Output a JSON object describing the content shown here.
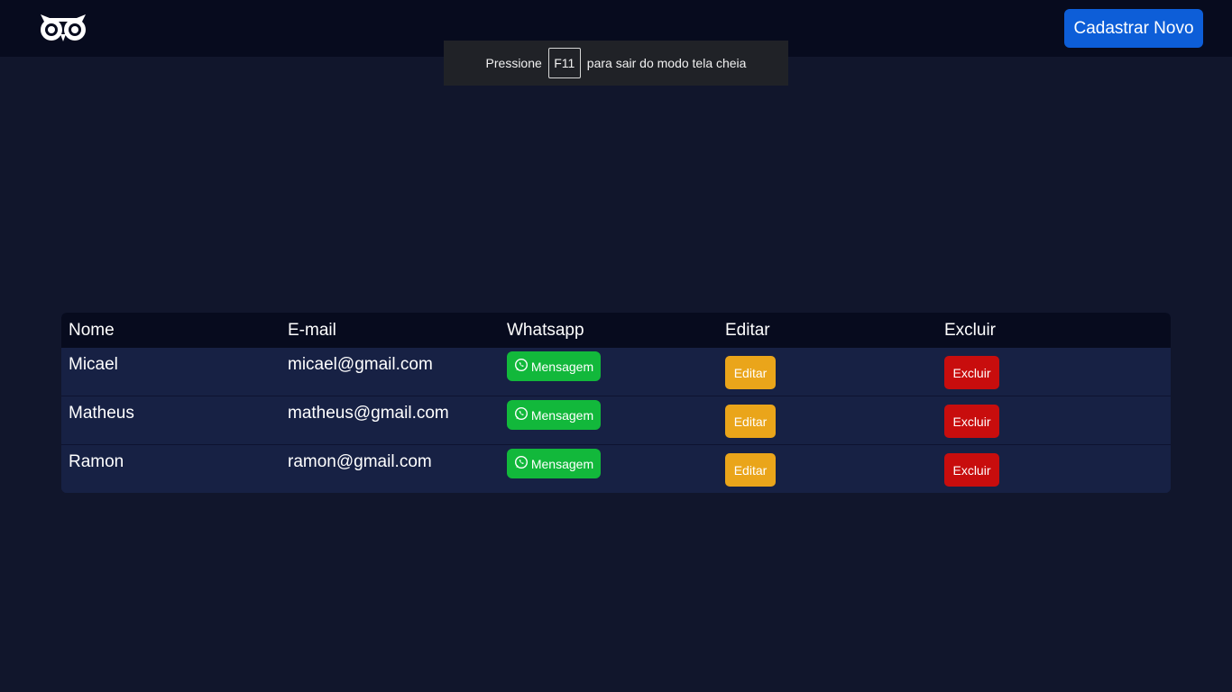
{
  "header": {
    "logo": "owl-logo-icon",
    "new_button_label": "Cadastrar Novo"
  },
  "fullscreen_notice": {
    "prefix": "Pressione",
    "key": "F11",
    "suffix": "para sair do modo tela cheia"
  },
  "table": {
    "columns": [
      "Nome",
      "E-mail",
      "Whatsapp",
      "Editar",
      "Excluir"
    ],
    "rows": [
      {
        "name": "Micael",
        "email": "micael@gmail.com",
        "whatsapp_label": "Mensagem",
        "edit_label": "Editar",
        "delete_label": "Excluir"
      },
      {
        "name": "Matheus",
        "email": "matheus@gmail.com",
        "whatsapp_label": "Mensagem",
        "edit_label": "Editar",
        "delete_label": "Excluir"
      },
      {
        "name": "Ramon",
        "email": "ramon@gmail.com",
        "whatsapp_label": "Mensagem",
        "edit_label": "Editar",
        "delete_label": "Excluir"
      }
    ]
  },
  "colors": {
    "background": "#11162c",
    "topbar": "#070b1e",
    "primary": "#0d5ed8",
    "whatsapp": "#12b83b",
    "edit": "#eaa51a",
    "delete": "#c80d0d"
  }
}
